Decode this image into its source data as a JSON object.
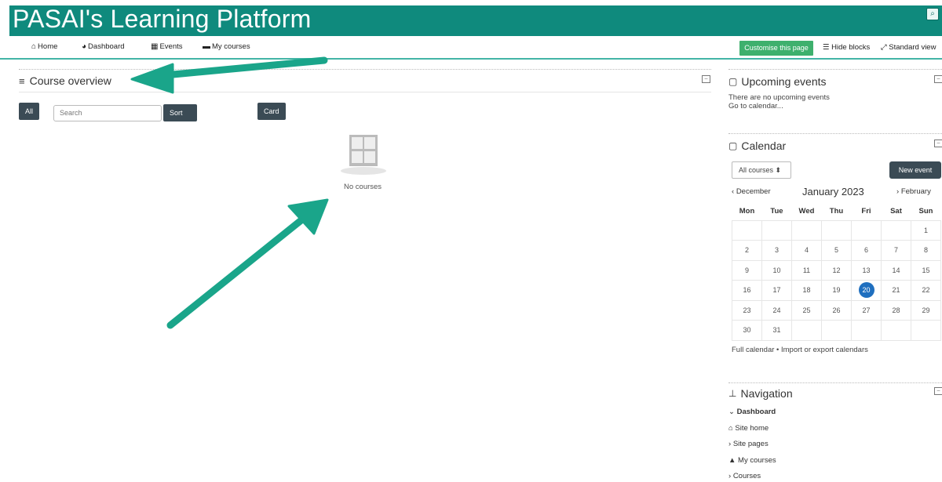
{
  "header": {
    "brand": "PASAI's Learning Platform"
  },
  "navbar": {
    "items": [
      {
        "icon": "home-icon",
        "label": "Home"
      },
      {
        "icon": "dashboard-icon",
        "label": "Dashboard"
      },
      {
        "icon": "calendar-icon",
        "label": "Events"
      },
      {
        "icon": "briefcase-icon",
        "label": "My courses"
      }
    ],
    "customise": "Customise this page",
    "hide_blocks": "Hide blocks",
    "standard_view": "Standard view"
  },
  "course_overview": {
    "title": "Course overview",
    "filter": "All",
    "search_placeholder": "Search",
    "sort": "Sort by course name",
    "view": "Card",
    "empty": "No courses"
  },
  "upcoming": {
    "title": "Upcoming events",
    "empty": "There are no upcoming events",
    "link": "Go to calendar..."
  },
  "calendar": {
    "title": "Calendar",
    "filter": "All courses",
    "new_event": "New event",
    "prev": "December",
    "month": "January 2023",
    "next": "February",
    "weekdays": [
      "Mon",
      "Tue",
      "Wed",
      "Thu",
      "Fri",
      "Sat",
      "Sun"
    ],
    "weeks": [
      [
        "",
        "",
        "",
        "",
        "",
        "",
        "1"
      ],
      [
        "2",
        "3",
        "4",
        "5",
        "6",
        "7",
        "8"
      ],
      [
        "9",
        "10",
        "11",
        "12",
        "13",
        "14",
        "15"
      ],
      [
        "16",
        "17",
        "18",
        "19",
        "20",
        "21",
        "22"
      ],
      [
        "23",
        "24",
        "25",
        "26",
        "27",
        "28",
        "29"
      ],
      [
        "30",
        "31",
        "",
        "",
        "",
        "",
        ""
      ]
    ],
    "today": "20",
    "footer": "Full calendar • Import or export calendars"
  },
  "navigation": {
    "title": "Navigation",
    "items": [
      "Dashboard",
      "Site home",
      "Site pages",
      "My courses",
      "Courses"
    ]
  },
  "colors": {
    "brand": "#0f8a7d",
    "accent": "#1aa58a",
    "today": "#1f6fbf"
  }
}
